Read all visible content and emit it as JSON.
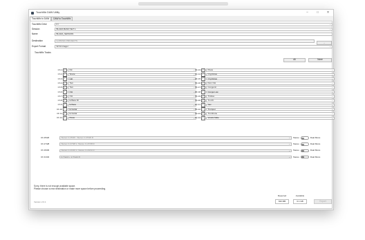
{
  "window": {
    "title": "TouchMix DAW Utility",
    "controls": {
      "minimize": "–",
      "maximize": "□",
      "close": "✕"
    }
  },
  "tabs": [
    {
      "label": "TouchMix to DAW"
    },
    {
      "label": "DAW to TouchMix"
    }
  ],
  "form": {
    "touchmix_drive": {
      "label": "TouchMix Drive",
      "value": "F:/"
    },
    "session": {
      "label": "Session",
      "value": "BLUES BAND SET 1"
    },
    "name": {
      "label": "Name",
      "value": "BLUES_SESSION"
    },
    "destination": {
      "label": "Destination",
      "value": "G:/MUSIC PROJECTS"
    },
    "export_format": {
      "label": "Export Format",
      "value": "32 bit integer"
    },
    "browse_label": "..."
  },
  "tracks_section": {
    "label": "TouchMix Tracks",
    "all_button": "All",
    "none_button": "None"
  },
  "tracks_left": [
    {
      "ch": "Ch 1",
      "name": "Kik"
    },
    {
      "ch": "Ch 2",
      "name": "Snare"
    },
    {
      "ch": "Ch 3",
      "name": "Hat"
    },
    {
      "ch": "Ch 4",
      "name": "Tom"
    },
    {
      "ch": "Ch 5",
      "name": "Tom"
    },
    {
      "ch": "Ch 6",
      "name": "OH"
    },
    {
      "ch": "Ch 7",
      "name": "OH"
    },
    {
      "ch": "Ch 8",
      "name": "E.Bass DI"
    },
    {
      "ch": "Ch 9",
      "name": "E.Bass"
    },
    {
      "ch": "Ch 10",
      "name": "E.Guitar"
    },
    {
      "ch": "Ch 11",
      "name": "E.Guitar"
    },
    {
      "ch": "Ch 12",
      "name": "Piano"
    }
  ],
  "tracks_right": [
    {
      "ch": "Ch 13",
      "name": "Piano"
    },
    {
      "ch": "Ch 14",
      "name": "Org Rotax"
    },
    {
      "ch": "Ch 15",
      "name": "Org Rotax"
    },
    {
      "ch": "Ch 16",
      "name": "Perc OH"
    },
    {
      "ch": "Ch 17",
      "name": "Conga Hi"
    },
    {
      "ch": "Ch 18",
      "name": "Conga Low"
    },
    {
      "ch": "Ch 19",
      "name": "Timbav"
    },
    {
      "ch": "Ch 20",
      "name": "Tm.Pc"
    },
    {
      "ch": "Ch 21",
      "name": "Sax"
    },
    {
      "ch": "Ch 22",
      "name": "Trumpet"
    },
    {
      "ch": "Ch 23",
      "name": "Trombone"
    },
    {
      "ch": "Ch 24",
      "name": "Vocals Male"
    }
  ],
  "stereo_pairs": [
    {
      "ch": "Ch 25/26",
      "value": "Stereo In 25/26 : Stereo In 25/26 R",
      "stereo_label": "Stereo",
      "dual_mono_label": "Dual Mono"
    },
    {
      "ch": "Ch 27/28",
      "value": "Stereo In 27/28 L: Stereo In 27/28 R",
      "stereo_label": "Stereo",
      "dual_mono_label": "Dual Mono"
    },
    {
      "ch": "Ch 29/30",
      "value": "Stereo In 29/30 L: Stereo In 29/30 R",
      "stereo_label": "Stereo",
      "dual_mono_label": "Dual Mono"
    },
    {
      "ch": "Ch 31/32",
      "value": "2-Track L: 2-Track R",
      "stereo_label": "Stereo",
      "dual_mono_label": "Dual Mono"
    }
  ],
  "status": {
    "line1": "Sorry, there is not enough available space.",
    "line2": "Please choose a new destination or make more space before proceeding."
  },
  "footer": {
    "version": "Version 2.0.1",
    "required_label": "Required",
    "available_label": "Available",
    "required_value": "633 MB",
    "available_value": "0.1 GB",
    "export_button": "Export"
  }
}
